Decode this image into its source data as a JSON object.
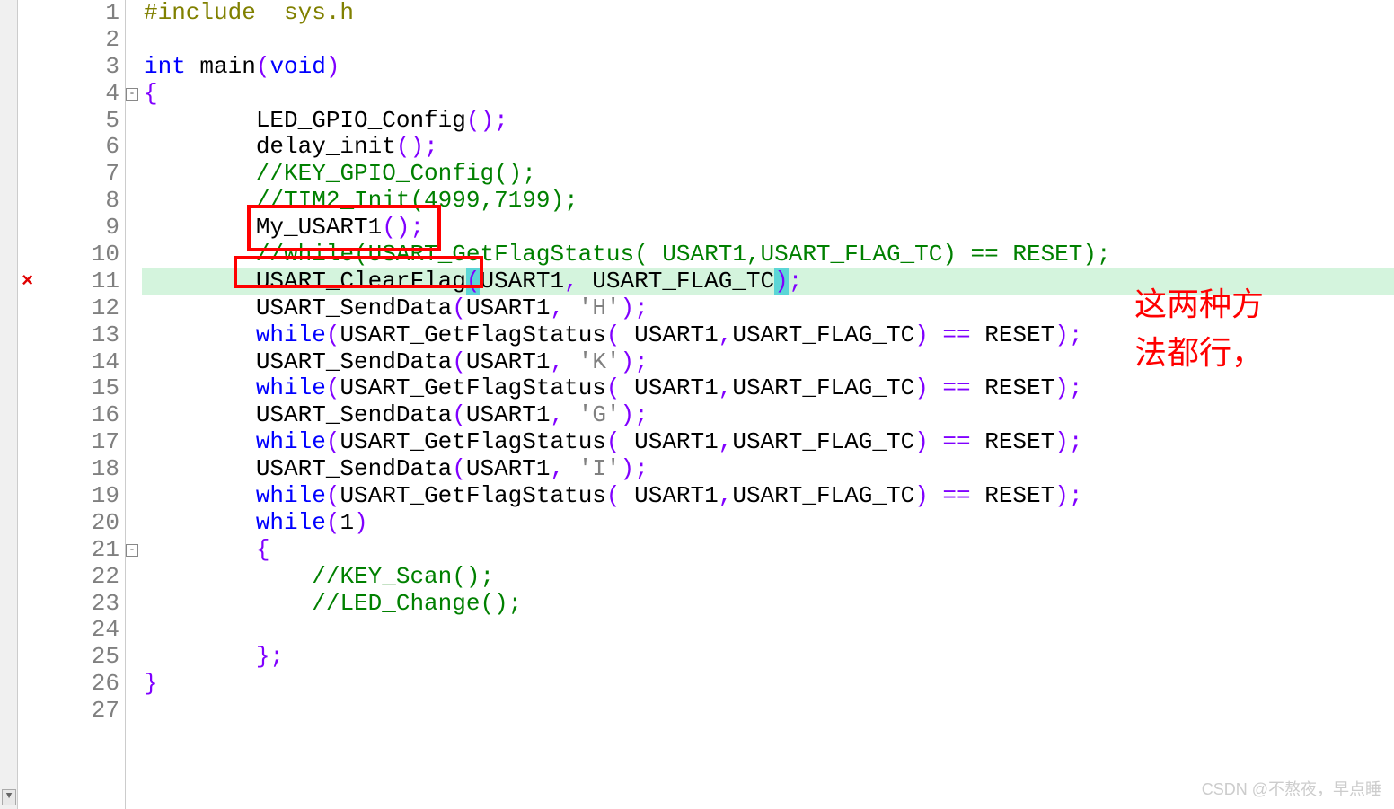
{
  "lines": [
    {
      "num": "1",
      "segments": [
        {
          "t": "#include  sys.h",
          "c": "preproc"
        }
      ]
    },
    {
      "num": "2",
      "segments": []
    },
    {
      "num": "3",
      "segments": [
        {
          "t": "int",
          "c": "kw-blue"
        },
        {
          "t": " main",
          "c": "text-black"
        },
        {
          "t": "(",
          "c": "kw-purple"
        },
        {
          "t": "void",
          "c": "kw-blue"
        },
        {
          "t": ")",
          "c": "kw-purple"
        }
      ]
    },
    {
      "num": "4",
      "fold": "-",
      "segments": [
        {
          "t": "{",
          "c": "kw-purple"
        }
      ]
    },
    {
      "num": "5",
      "segments": [
        {
          "t": "        LED_GPIO_Config",
          "c": "text-black"
        },
        {
          "t": "();",
          "c": "kw-purple"
        }
      ]
    },
    {
      "num": "6",
      "segments": [
        {
          "t": "        delay_init",
          "c": "text-black"
        },
        {
          "t": "();",
          "c": "kw-purple"
        }
      ]
    },
    {
      "num": "7",
      "segments": [
        {
          "t": "        ",
          "c": "text-black"
        },
        {
          "t": "//KEY_GPIO_Config();",
          "c": "comment-green"
        }
      ]
    },
    {
      "num": "8",
      "segments": [
        {
          "t": "        ",
          "c": "text-black"
        },
        {
          "t": "//TIM2_Init(4999,7199);",
          "c": "comment-green"
        }
      ]
    },
    {
      "num": "9",
      "segments": [
        {
          "t": "        My_USART1",
          "c": "text-black"
        },
        {
          "t": "();",
          "c": "kw-purple"
        }
      ]
    },
    {
      "num": "10",
      "segments": [
        {
          "t": "        ",
          "c": "text-black"
        },
        {
          "t": "//while(USART_GetFlagStatus( USART1,USART_FLAG_TC) == RESET);",
          "c": "comment-green"
        }
      ]
    },
    {
      "num": "11",
      "hl": true,
      "marker": "×",
      "segments": [
        {
          "t": "        USART_ClearFlag",
          "c": "text-black"
        },
        {
          "t": "(",
          "c": "kw-purple paren-highlight"
        },
        {
          "t": "USART1",
          "c": "text-black"
        },
        {
          "t": ",",
          "c": "kw-purple"
        },
        {
          "t": " USART_FLAG_TC",
          "c": "text-black"
        },
        {
          "t": ")",
          "c": "kw-purple paren-highlight"
        },
        {
          "t": ";",
          "c": "kw-purple"
        }
      ]
    },
    {
      "num": "12",
      "segments": [
        {
          "t": "        USART_SendData",
          "c": "text-black"
        },
        {
          "t": "(",
          "c": "kw-purple"
        },
        {
          "t": "USART1",
          "c": "text-black"
        },
        {
          "t": ",",
          "c": "kw-purple"
        },
        {
          "t": " ",
          "c": "text-black"
        },
        {
          "t": "'H'",
          "c": "string-gray"
        },
        {
          "t": ");",
          "c": "kw-purple"
        }
      ]
    },
    {
      "num": "13",
      "segments": [
        {
          "t": "        ",
          "c": "text-black"
        },
        {
          "t": "while",
          "c": "kw-blue"
        },
        {
          "t": "(",
          "c": "kw-purple"
        },
        {
          "t": "USART_GetFlagStatus",
          "c": "text-black"
        },
        {
          "t": "(",
          "c": "kw-purple"
        },
        {
          "t": " USART1",
          "c": "text-black"
        },
        {
          "t": ",",
          "c": "kw-purple"
        },
        {
          "t": "USART_FLAG_TC",
          "c": "text-black"
        },
        {
          "t": ")",
          "c": "kw-purple"
        },
        {
          "t": " ",
          "c": "text-black"
        },
        {
          "t": "==",
          "c": "kw-purple"
        },
        {
          "t": " RESET",
          "c": "text-black"
        },
        {
          "t": ");",
          "c": "kw-purple"
        }
      ]
    },
    {
      "num": "14",
      "segments": [
        {
          "t": "        USART_SendData",
          "c": "text-black"
        },
        {
          "t": "(",
          "c": "kw-purple"
        },
        {
          "t": "USART1",
          "c": "text-black"
        },
        {
          "t": ",",
          "c": "kw-purple"
        },
        {
          "t": " ",
          "c": "text-black"
        },
        {
          "t": "'K'",
          "c": "string-gray"
        },
        {
          "t": ");",
          "c": "kw-purple"
        }
      ]
    },
    {
      "num": "15",
      "segments": [
        {
          "t": "        ",
          "c": "text-black"
        },
        {
          "t": "while",
          "c": "kw-blue"
        },
        {
          "t": "(",
          "c": "kw-purple"
        },
        {
          "t": "USART_GetFlagStatus",
          "c": "text-black"
        },
        {
          "t": "(",
          "c": "kw-purple"
        },
        {
          "t": " USART1",
          "c": "text-black"
        },
        {
          "t": ",",
          "c": "kw-purple"
        },
        {
          "t": "USART_FLAG_TC",
          "c": "text-black"
        },
        {
          "t": ")",
          "c": "kw-purple"
        },
        {
          "t": " ",
          "c": "text-black"
        },
        {
          "t": "==",
          "c": "kw-purple"
        },
        {
          "t": " RESET",
          "c": "text-black"
        },
        {
          "t": ");",
          "c": "kw-purple"
        }
      ]
    },
    {
      "num": "16",
      "segments": [
        {
          "t": "        USART_SendData",
          "c": "text-black"
        },
        {
          "t": "(",
          "c": "kw-purple"
        },
        {
          "t": "USART1",
          "c": "text-black"
        },
        {
          "t": ",",
          "c": "kw-purple"
        },
        {
          "t": " ",
          "c": "text-black"
        },
        {
          "t": "'G'",
          "c": "string-gray"
        },
        {
          "t": ");",
          "c": "kw-purple"
        }
      ]
    },
    {
      "num": "17",
      "segments": [
        {
          "t": "        ",
          "c": "text-black"
        },
        {
          "t": "while",
          "c": "kw-blue"
        },
        {
          "t": "(",
          "c": "kw-purple"
        },
        {
          "t": "USART_GetFlagStatus",
          "c": "text-black"
        },
        {
          "t": "(",
          "c": "kw-purple"
        },
        {
          "t": " USART1",
          "c": "text-black"
        },
        {
          "t": ",",
          "c": "kw-purple"
        },
        {
          "t": "USART_FLAG_TC",
          "c": "text-black"
        },
        {
          "t": ")",
          "c": "kw-purple"
        },
        {
          "t": " ",
          "c": "text-black"
        },
        {
          "t": "==",
          "c": "kw-purple"
        },
        {
          "t": " RESET",
          "c": "text-black"
        },
        {
          "t": ");",
          "c": "kw-purple"
        }
      ]
    },
    {
      "num": "18",
      "segments": [
        {
          "t": "        USART_SendData",
          "c": "text-black"
        },
        {
          "t": "(",
          "c": "kw-purple"
        },
        {
          "t": "USART1",
          "c": "text-black"
        },
        {
          "t": ",",
          "c": "kw-purple"
        },
        {
          "t": " ",
          "c": "text-black"
        },
        {
          "t": "'I'",
          "c": "string-gray"
        },
        {
          "t": ");",
          "c": "kw-purple"
        }
      ]
    },
    {
      "num": "19",
      "segments": [
        {
          "t": "        ",
          "c": "text-black"
        },
        {
          "t": "while",
          "c": "kw-blue"
        },
        {
          "t": "(",
          "c": "kw-purple"
        },
        {
          "t": "USART_GetFlagStatus",
          "c": "text-black"
        },
        {
          "t": "(",
          "c": "kw-purple"
        },
        {
          "t": " USART1",
          "c": "text-black"
        },
        {
          "t": ",",
          "c": "kw-purple"
        },
        {
          "t": "USART_FLAG_TC",
          "c": "text-black"
        },
        {
          "t": ")",
          "c": "kw-purple"
        },
        {
          "t": " ",
          "c": "text-black"
        },
        {
          "t": "==",
          "c": "kw-purple"
        },
        {
          "t": " RESET",
          "c": "text-black"
        },
        {
          "t": ");",
          "c": "kw-purple"
        }
      ]
    },
    {
      "num": "20",
      "segments": [
        {
          "t": "        ",
          "c": "text-black"
        },
        {
          "t": "while",
          "c": "kw-blue"
        },
        {
          "t": "(",
          "c": "kw-purple"
        },
        {
          "t": "1",
          "c": "text-black"
        },
        {
          "t": ")",
          "c": "kw-purple"
        }
      ]
    },
    {
      "num": "21",
      "fold": "-",
      "segments": [
        {
          "t": "        ",
          "c": "text-black"
        },
        {
          "t": "{",
          "c": "kw-purple"
        }
      ]
    },
    {
      "num": "22",
      "segments": [
        {
          "t": "            ",
          "c": "text-black"
        },
        {
          "t": "//KEY_Scan();",
          "c": "comment-green"
        }
      ]
    },
    {
      "num": "23",
      "segments": [
        {
          "t": "            ",
          "c": "text-black"
        },
        {
          "t": "//LED_Change();",
          "c": "comment-green"
        }
      ]
    },
    {
      "num": "24",
      "segments": []
    },
    {
      "num": "25",
      "segments": [
        {
          "t": "        ",
          "c": "text-black"
        },
        {
          "t": "};",
          "c": "kw-purple"
        }
      ]
    },
    {
      "num": "26",
      "segments": [
        {
          "t": "}",
          "c": "kw-purple"
        }
      ]
    },
    {
      "num": "27",
      "segments": []
    }
  ],
  "annotation": {
    "line1": "这两种方",
    "line2": "法都行，"
  },
  "watermark": "CSDN @不熬夜，早点睡",
  "scroll_glyph": "▼"
}
